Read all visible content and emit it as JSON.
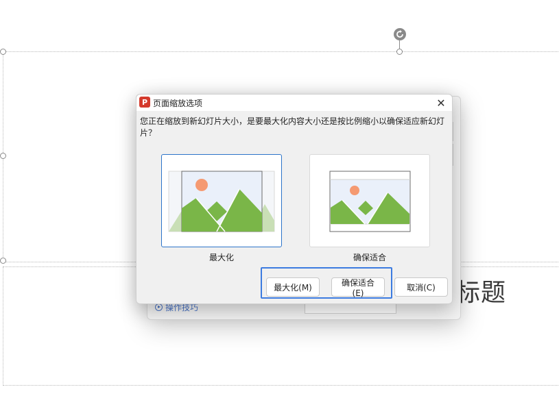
{
  "background": {
    "slide_title_fragment": "标题",
    "tips_label": "操作技巧"
  },
  "dialog": {
    "title": "页面缩放选项",
    "app_icon_letter": "P",
    "close_symbol": "✕",
    "message": "您正在缩放到新幻灯片大小，是要最大化内容大小还是按比例缩小以确保适应新幻灯片？",
    "options": {
      "maximize_caption": "最大化",
      "fit_caption": "确保适合",
      "selected": "maximize"
    },
    "buttons": {
      "maximize": "最大化(M)",
      "fit": "确保适合(E)",
      "cancel": "取消(C)"
    }
  },
  "colors": {
    "accent": "#2b73c9",
    "highlight_box": "#3c7be0",
    "app_icon": "#d43a2c",
    "mountain": "#7ab648",
    "sun": "#f59a72",
    "sky": "#eaf0fa"
  }
}
